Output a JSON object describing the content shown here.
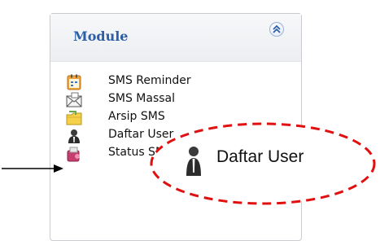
{
  "module": {
    "title": "Module",
    "collapse_icon": "double-chevron-up-icon",
    "items": [
      {
        "label": "SMS Reminder",
        "icon": "calendar-icon"
      },
      {
        "label": "SMS Massal",
        "icon": "envelope-icon"
      },
      {
        "label": "Arsip SMS",
        "icon": "folder-icon"
      },
      {
        "label": "Daftar User",
        "icon": "user-icon"
      },
      {
        "label": "Status SMS",
        "icon": "status-icon"
      }
    ]
  },
  "callout": {
    "label": "Daftar User",
    "icon": "user-icon",
    "border_color": "#e01010"
  },
  "colors": {
    "title": "#2b5fa8",
    "panel_border": "#c8cbd0",
    "arrow": "#000000"
  }
}
